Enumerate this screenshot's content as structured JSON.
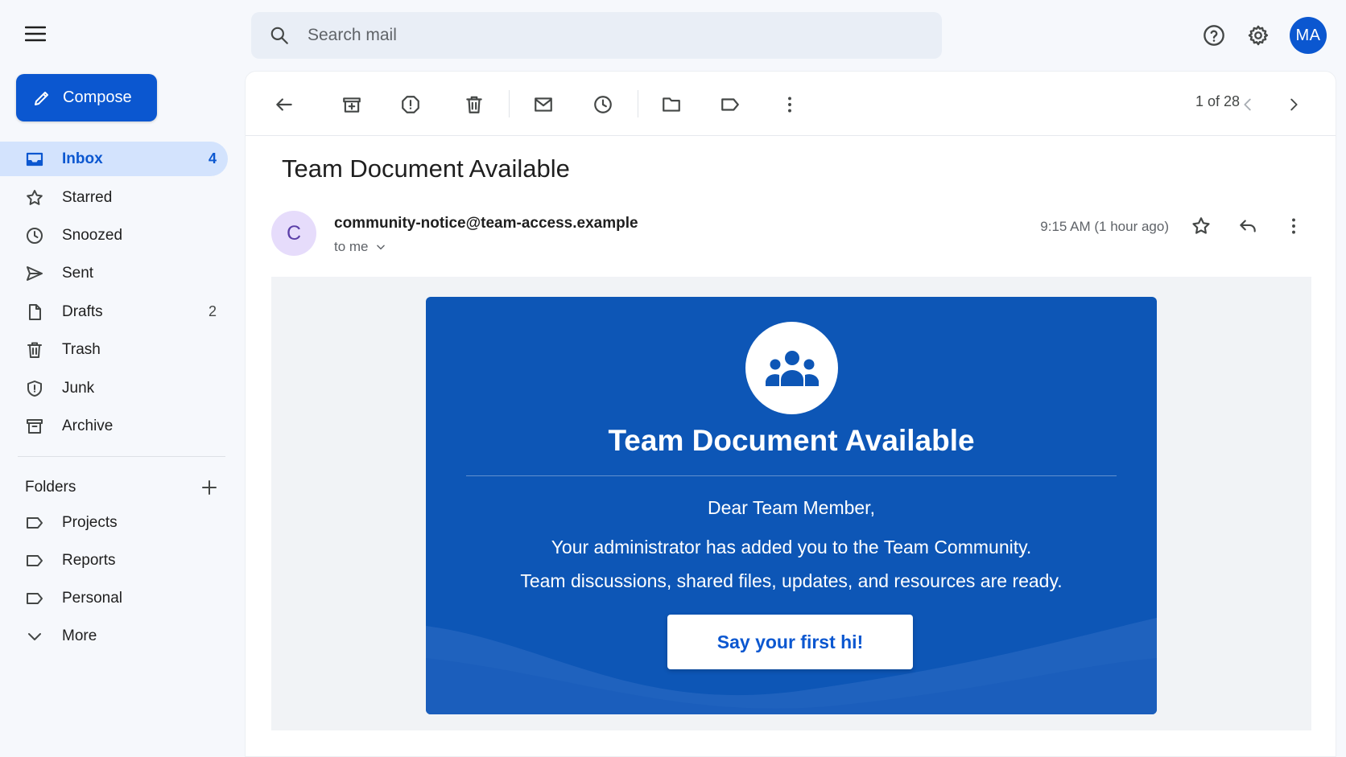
{
  "topbar": {
    "search_placeholder": "Search mail",
    "avatar_initials": "MA"
  },
  "sidebar": {
    "compose_label": "Compose",
    "items": [
      {
        "label": "Inbox",
        "count": "4",
        "icon": "inbox-icon",
        "active": true
      },
      {
        "label": "Starred",
        "count": "",
        "icon": "star-icon"
      },
      {
        "label": "Snoozed",
        "count": "",
        "icon": "clock-icon"
      },
      {
        "label": "Sent",
        "count": "",
        "icon": "send-icon"
      },
      {
        "label": "Drafts",
        "count": "2",
        "icon": "draft-icon"
      },
      {
        "label": "Trash",
        "count": "",
        "icon": "trash-icon"
      },
      {
        "label": "Junk",
        "count": "",
        "icon": "shield-icon"
      },
      {
        "label": "Archive",
        "count": "",
        "icon": "archive-icon"
      }
    ],
    "folders_heading": "Folders",
    "folders": [
      {
        "label": "Projects",
        "icon": "label-icon"
      },
      {
        "label": "Reports",
        "icon": "label-icon"
      },
      {
        "label": "Personal",
        "icon": "label-icon"
      }
    ],
    "more_label": "More"
  },
  "toolbar": {
    "page_count": "1 of 28"
  },
  "email": {
    "subject": "Team Document Available",
    "sender_initial": "C",
    "sender": "community-notice@team-access.example",
    "recipient": "to me",
    "timestamp": "9:15 AM (1 hour ago)",
    "body": {
      "title": "Team Document Available",
      "greeting": "Dear Team Member,",
      "line1": "Your administrator has added you to the Team Community.",
      "line2": "Team discussions, shared files, updates, and resources are ready.",
      "cta_label": "Say your first hi!"
    }
  },
  "colors": {
    "accent": "#0b57d0",
    "banner": "#0d56b6",
    "active_nav_bg": "#d3e3fd"
  }
}
